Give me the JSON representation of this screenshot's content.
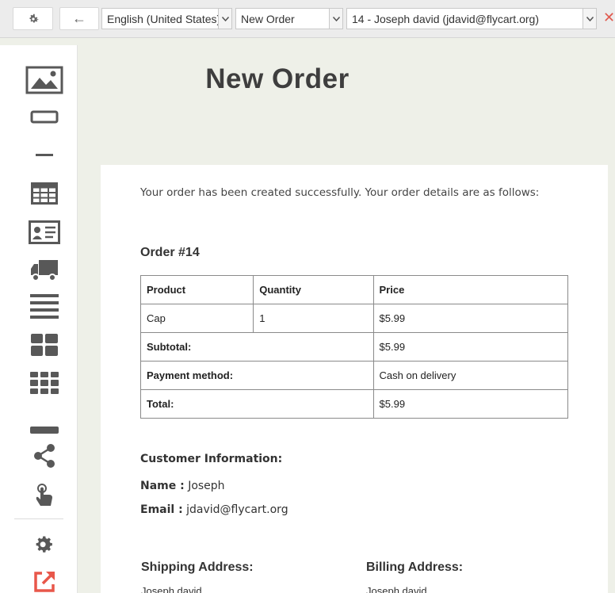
{
  "toolbar": {
    "language": "English (United States)",
    "template": "New Order",
    "customer": "14 - Joseph david (jdavid@flycart.org)",
    "close_glyph": "✕",
    "back_glyph": "←"
  },
  "sidebar": {
    "icons": [
      "image-icon",
      "button-icon",
      "divider-icon",
      "table-icon",
      "contact-card-icon",
      "shipping-truck-icon",
      "text-lines-icon",
      "grid-2x2-icon",
      "grid-3x3-icon",
      "spacer-bar-icon",
      "share-icon",
      "touch-icon",
      "settings-gear-icon",
      "external-link-icon"
    ]
  },
  "email": {
    "title": "New Order",
    "intro": "Your order has been created successfully. Your order details are as follows:",
    "order_heading": "Order #14",
    "table": {
      "headers": [
        "Product",
        "Quantity",
        "Price"
      ],
      "rows": [
        {
          "product": "Cap",
          "quantity": "1",
          "price": "$5.99"
        }
      ],
      "totals": [
        {
          "label": "Subtotal:",
          "value": "$5.99"
        },
        {
          "label": "Payment method:",
          "value": "Cash on delivery"
        },
        {
          "label": "Total:",
          "value": "$5.99"
        }
      ]
    },
    "customer": {
      "heading": "Customer Information:",
      "name_label": "Name :",
      "name": "Joseph",
      "email_label": "Email :",
      "email": "jdavid@flycart.org"
    },
    "shipping": {
      "heading": "Shipping Address:",
      "line1": "Joseph david"
    },
    "billing": {
      "heading": "Billing Address:",
      "line1": "Joseph david"
    }
  },
  "colors": {
    "accent_close": "#e05a4f",
    "icon_gray": "#585858",
    "external_link": "#e8574a"
  }
}
